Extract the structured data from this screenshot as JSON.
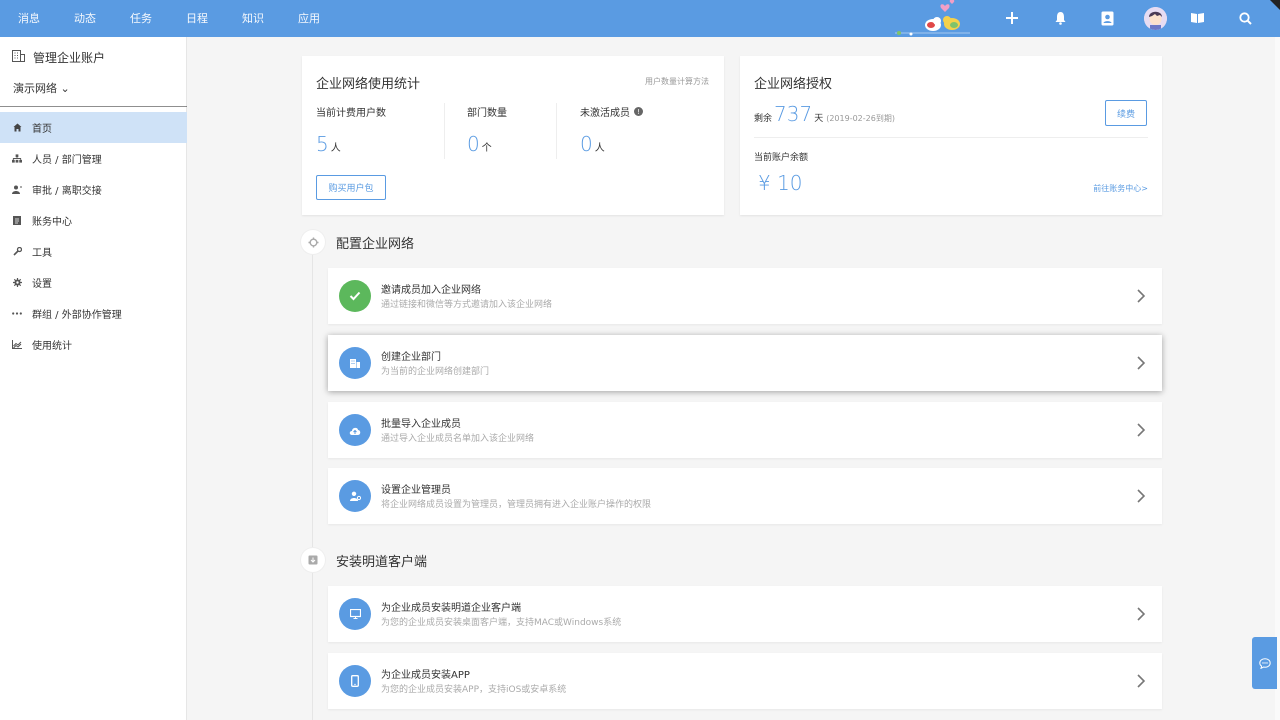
{
  "topnav": {
    "items": [
      "消息",
      "动态",
      "任务",
      "日程",
      "知识",
      "应用"
    ]
  },
  "top_icons": [
    "add-icon",
    "bell-icon",
    "contacts-icon",
    "avatar",
    "book-icon",
    "search-icon"
  ],
  "sidebar": {
    "header": "管理企业账户",
    "network": "演示网络 ⌄",
    "items": [
      {
        "label": "首页",
        "icon": "home-icon",
        "active": true
      },
      {
        "label": "人员 / 部门管理",
        "icon": "org-icon",
        "active": false
      },
      {
        "label": "审批 / 离职交接",
        "icon": "user-transfer-icon",
        "active": false
      },
      {
        "label": "账务中心",
        "icon": "ledger-icon",
        "active": false
      },
      {
        "label": "工具",
        "icon": "wrench-icon",
        "active": false
      },
      {
        "label": "设置",
        "icon": "gear-icon",
        "active": false
      },
      {
        "label": "群组 / 外部协作管理",
        "icon": "more-icon",
        "active": false
      },
      {
        "label": "使用统计",
        "icon": "chart-icon",
        "active": false
      }
    ]
  },
  "usage_card": {
    "title": "企业网络使用统计",
    "method_link": "用户数量计算方法",
    "stats": [
      {
        "label": "当前计费用户数",
        "value": "5",
        "unit": "人"
      },
      {
        "label": "部门数量",
        "value": "0",
        "unit": "个"
      },
      {
        "label": "未激活成员",
        "value": "0",
        "unit": "人"
      }
    ],
    "buy_button": "购买用户包"
  },
  "license_card": {
    "title": "企业网络授权",
    "remaining_prefix": "剩余",
    "remaining_days": "737",
    "days_unit": "天",
    "expire_note": "(2019-02-26到期)",
    "renew_button": "续费",
    "balance_label": "当前账户余额",
    "balance_value": "¥ 10",
    "billing_link": "前往账务中心>"
  },
  "section_config": {
    "title": "配置企业网络",
    "tasks": [
      {
        "title": "邀请成员加入企业网络",
        "desc": "通过链接和微信等方式邀请加入该企业网络",
        "icon": "check-icon",
        "color": "#5cb85c"
      },
      {
        "title": "创建企业部门",
        "desc": "为当前的企业网络创建部门",
        "icon": "building-icon",
        "color": "#5a9be2"
      },
      {
        "title": "批量导入企业成员",
        "desc": "通过导入企业成员名单加入该企业网络",
        "icon": "cloud-upload-icon",
        "color": "#5a9be2"
      },
      {
        "title": "设置企业管理员",
        "desc": "将企业网络成员设置为管理员，管理员拥有进入企业账户操作的权限",
        "icon": "admin-user-icon",
        "color": "#5a9be2"
      }
    ]
  },
  "section_install": {
    "title": "安装明道客户端",
    "tasks": [
      {
        "title": "为企业成员安装明道企业客户端",
        "desc": "为您的企业成员安装桌面客户端，支持MAC或Windows系统",
        "icon": "monitor-icon",
        "color": "#5a9be2"
      },
      {
        "title": "为企业成员安装APP",
        "desc": "为您的企业成员安装APP，支持iOS或安卓系统",
        "icon": "phone-icon",
        "color": "#5a9be2"
      }
    ]
  },
  "float_button": "chat-bubble-icon",
  "colors": {
    "accent": "#5a9be2",
    "success": "#5cb85c",
    "active_bg": "#cfe2f7"
  }
}
